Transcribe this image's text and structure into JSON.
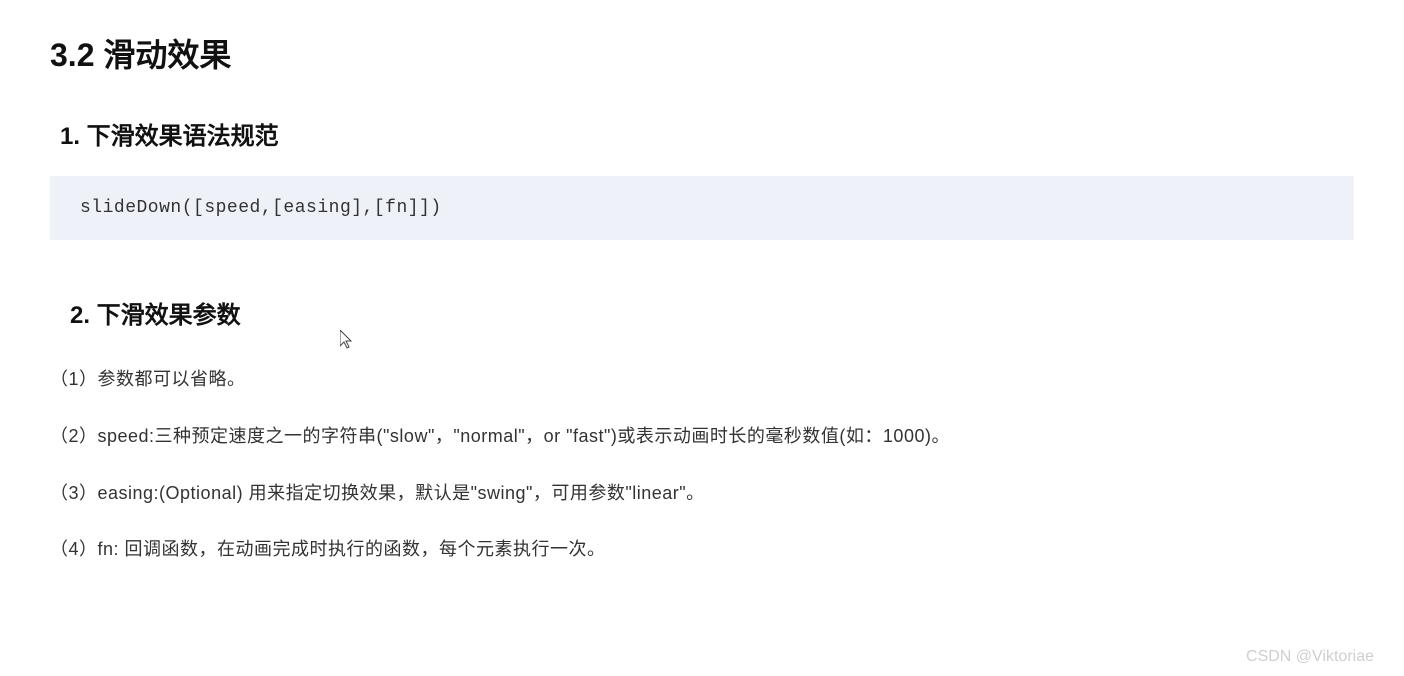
{
  "section_title": "3.2  滑动效果",
  "subsection1_title": "1. 下滑效果语法规范",
  "code": "slideDown([speed,[easing],[fn]])",
  "subsection2_title": "2. 下滑效果参数",
  "params": {
    "p1": "（1）参数都可以省略。",
    "p2": "（2）speed:三种预定速度之一的字符串(\"slow\"，\"normal\"，or \"fast\")或表示动画时长的毫秒数值(如：1000)。",
    "p3": "（3）easing:(Optional) 用来指定切换效果，默认是\"swing\"，可用参数\"linear\"。",
    "p4": "（4）fn: 回调函数，在动画完成时执行的函数，每个元素执行一次。"
  },
  "watermark": "CSDN @Viktoriae"
}
